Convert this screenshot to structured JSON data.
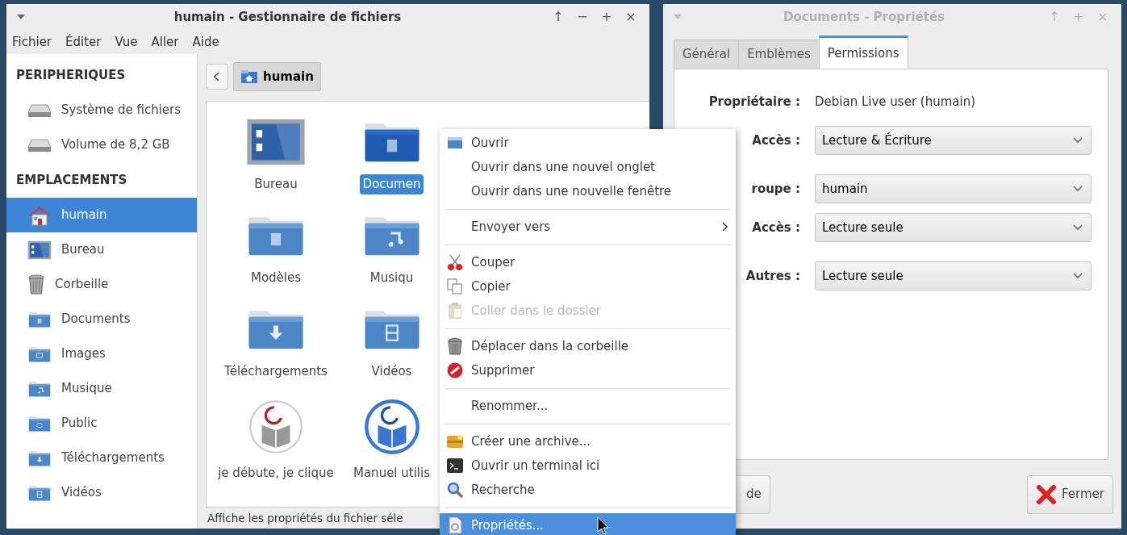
{
  "file_manager": {
    "title": "humain - Gestionnaire de fichiers",
    "window_controls": [
      "↑",
      "−",
      "+",
      "×"
    ],
    "menu_bar": [
      "Fichier",
      "Éditer",
      "Vue",
      "Aller",
      "Aide"
    ],
    "sidebar": [
      {
        "title": "PERIPHERIQUES",
        "items": [
          {
            "label": "Système de fichiers",
            "selected": false
          },
          {
            "label": "Volume de 8,2 GB",
            "selected": false
          }
        ]
      },
      {
        "title": "EMPLACEMENTS",
        "items": [
          {
            "label": "humain",
            "selected": true
          },
          {
            "label": "Bureau",
            "selected": false
          },
          {
            "label": "Corbeille",
            "selected": false
          },
          {
            "label": "Documents",
            "selected": false
          },
          {
            "label": "Images",
            "selected": false
          },
          {
            "label": "Musique",
            "selected": false
          },
          {
            "label": "Public",
            "selected": false
          },
          {
            "label": "Téléchargements",
            "selected": false
          },
          {
            "label": "Vidéos",
            "selected": false
          }
        ]
      }
    ],
    "path_bar": {
      "crumb": "humain"
    },
    "files": [
      {
        "label": "Bureau",
        "selected": false
      },
      {
        "label": "Documen",
        "selected": true
      },
      {
        "label": "Modèles",
        "selected": false
      },
      {
        "label": "Musiqu",
        "selected": false
      },
      {
        "label": "Téléchargements",
        "selected": false
      },
      {
        "label": "Vidéos",
        "selected": false
      },
      {
        "label": "je débute, je clique",
        "selected": false
      },
      {
        "label": "Manuel utilis",
        "selected": false
      }
    ],
    "status_bar": "Affiche les propriétés du fichier séle"
  },
  "properties": {
    "title": "Documents - Propriétés",
    "window_controls": [
      "↑",
      "+",
      "×"
    ],
    "tabs": [
      {
        "label": "Général",
        "selected": false
      },
      {
        "label": "Emblèmes",
        "selected": false
      },
      {
        "label": "Permissions",
        "selected": true
      }
    ],
    "sections": [
      {
        "rows": [
          {
            "kind": "text",
            "label": "Propriétaire :",
            "value": "Debian Live user (humain)"
          },
          {
            "kind": "select",
            "label": "Accès :",
            "value": "Lecture & Écriture"
          }
        ]
      },
      {
        "rows": [
          {
            "kind": "select",
            "label": "roupe :",
            "value": "humain"
          },
          {
            "kind": "select",
            "label": "Accès :",
            "value": "Lecture seule"
          }
        ]
      },
      {
        "rows": [
          {
            "kind": "select",
            "label": "Autres :",
            "value": "Lecture seule"
          }
        ]
      }
    ],
    "buttons": [
      "de",
      "Fermer"
    ]
  },
  "context_menu": [
    {
      "kind": "item",
      "label": "Ouvrir",
      "disabled": false,
      "selected": false
    },
    {
      "kind": "item",
      "label": "Ouvrir dans une nouvel onglet",
      "disabled": false,
      "selected": false
    },
    {
      "kind": "item",
      "label": "Ouvrir dans une nouvelle fenêtre",
      "disabled": false,
      "selected": false
    },
    {
      "kind": "separator"
    },
    {
      "kind": "submenu",
      "label": "Envoyer vers",
      "disabled": false,
      "selected": false
    },
    {
      "kind": "separator"
    },
    {
      "kind": "item",
      "label": "Couper",
      "disabled": false,
      "selected": false
    },
    {
      "kind": "item",
      "label": "Copier",
      "disabled": false,
      "selected": false
    },
    {
      "kind": "item",
      "label": "Coller dans le dossier",
      "disabled": true,
      "selected": false
    },
    {
      "kind": "separator"
    },
    {
      "kind": "item",
      "label": "Déplacer  dans la corbeille",
      "disabled": false,
      "selected": false
    },
    {
      "kind": "item",
      "label": "Supprimer",
      "disabled": false,
      "selected": false
    },
    {
      "kind": "separator"
    },
    {
      "kind": "item",
      "label": "Renommer...",
      "disabled": false,
      "selected": false
    },
    {
      "kind": "separator"
    },
    {
      "kind": "item",
      "label": "Créer une archive...",
      "disabled": false,
      "selected": false
    },
    {
      "kind": "item",
      "label": "Ouvrir un terminal ici",
      "disabled": false,
      "selected": false
    },
    {
      "kind": "item",
      "label": "Recherche",
      "disabled": false,
      "selected": false
    },
    {
      "kind": "separator"
    },
    {
      "kind": "item",
      "label": "Propriétés...",
      "disabled": false,
      "selected": true
    }
  ]
}
